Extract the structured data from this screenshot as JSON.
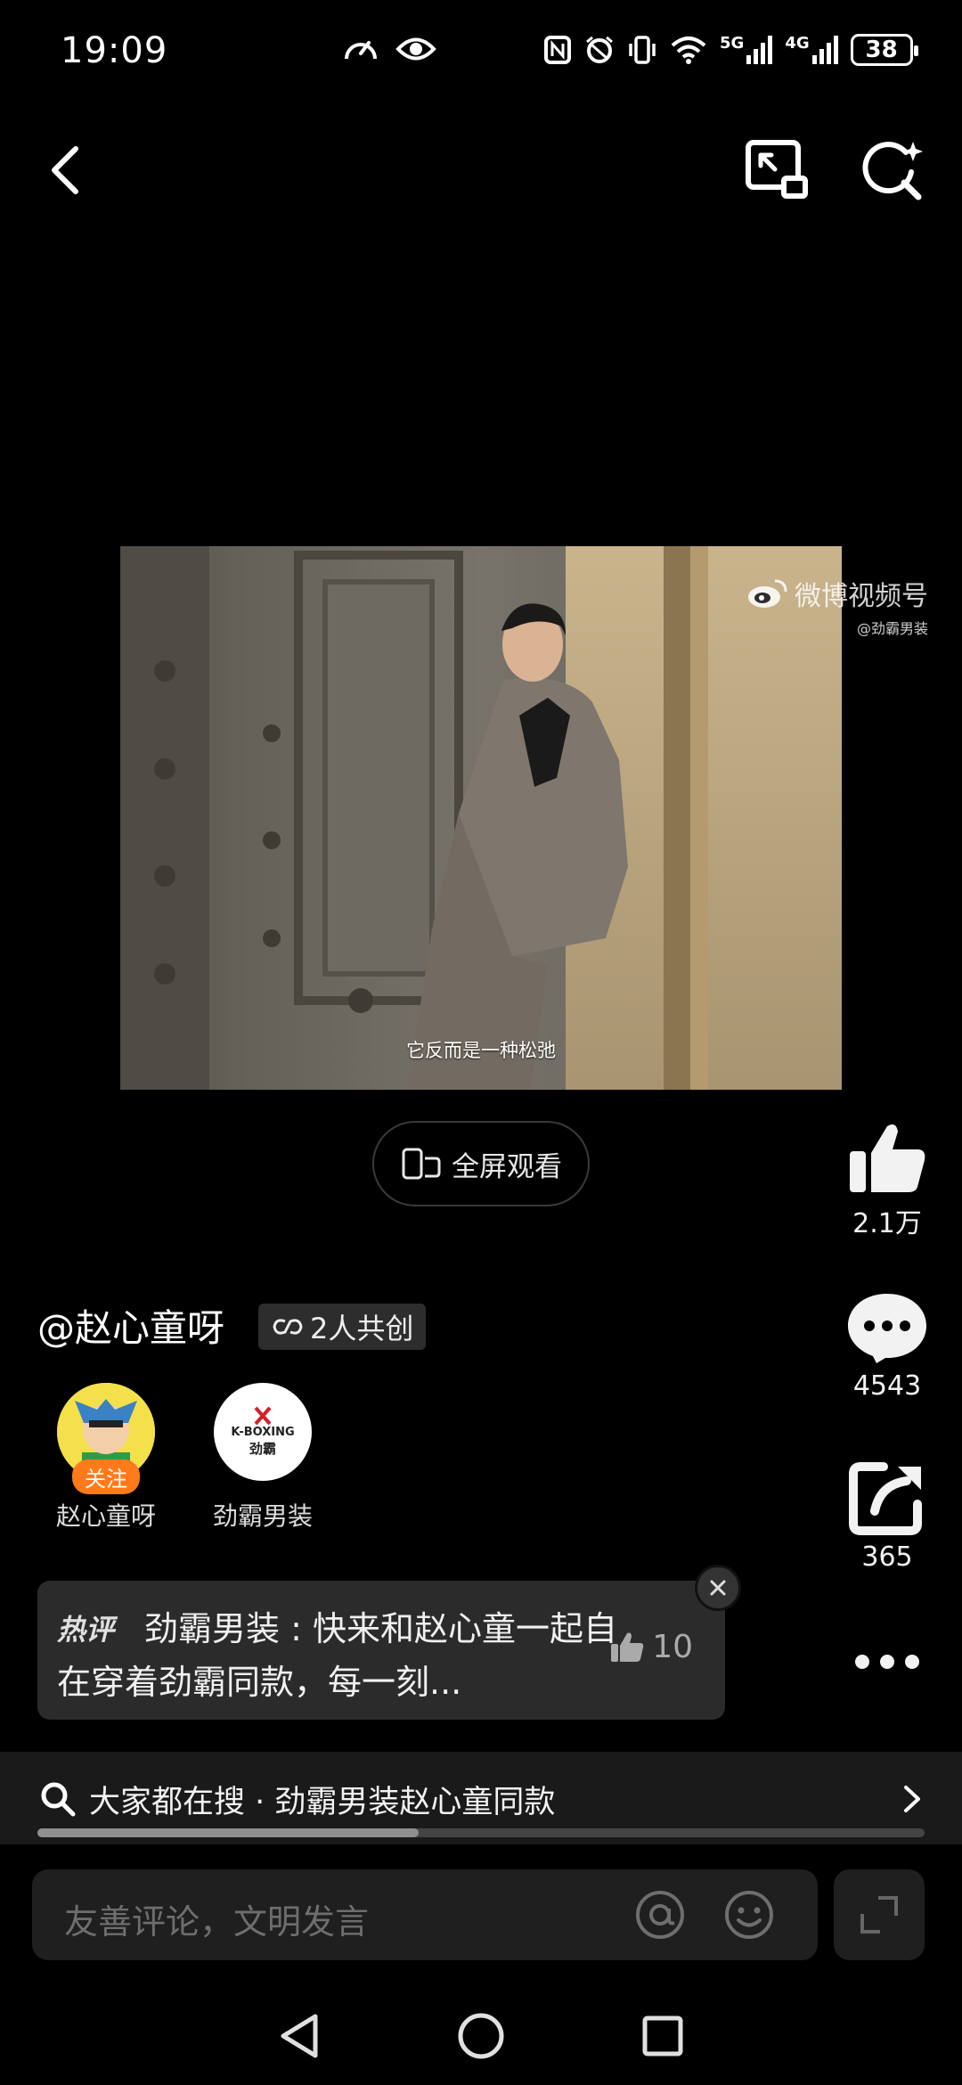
{
  "status_bar": {
    "time": "19:09",
    "network_1": "5G",
    "network_2": "4G",
    "battery": "38",
    "icons": [
      "speed-icon",
      "eye-icon",
      "nfc-icon",
      "alarm-icon",
      "vibrate-icon",
      "wifi-icon",
      "signal-icon",
      "signal-icon",
      "battery-icon"
    ]
  },
  "top_nav": {
    "icons": [
      "back-icon",
      "picture-in-picture-icon",
      "ai-search-icon"
    ]
  },
  "video": {
    "subtitle": "它反而是一种松弛",
    "watermark_brand": "微博视频号",
    "watermark_handle": "@劲霸男装"
  },
  "fullscreen_button": {
    "label": "全屏观看"
  },
  "rail": {
    "likes": "2.1万",
    "comments": "4543",
    "shares": "365"
  },
  "author": {
    "name": "@赵心童呀",
    "cocreate_label": "2人共创"
  },
  "creators": [
    {
      "name": "赵心童呀",
      "badge": "关注"
    },
    {
      "name": "劲霸男装",
      "logo_text_1": "K-BOXING",
      "logo_text_2": "劲霸"
    }
  ],
  "hot_comment": {
    "tag": "热评",
    "text": "劲霸男装 : 快来和赵心童一起自在穿着劲霸同款，每一刻...",
    "likes": "10"
  },
  "search_strip": {
    "text": "大家都在搜 · 劲霸男装赵心童同款",
    "progress": 0.43
  },
  "comment_bar": {
    "placeholder": "友善评论，文明发言"
  },
  "colors": {
    "background": "#000000",
    "follow_badge": "#ff7a1a",
    "panel": "#2b2b2b"
  }
}
